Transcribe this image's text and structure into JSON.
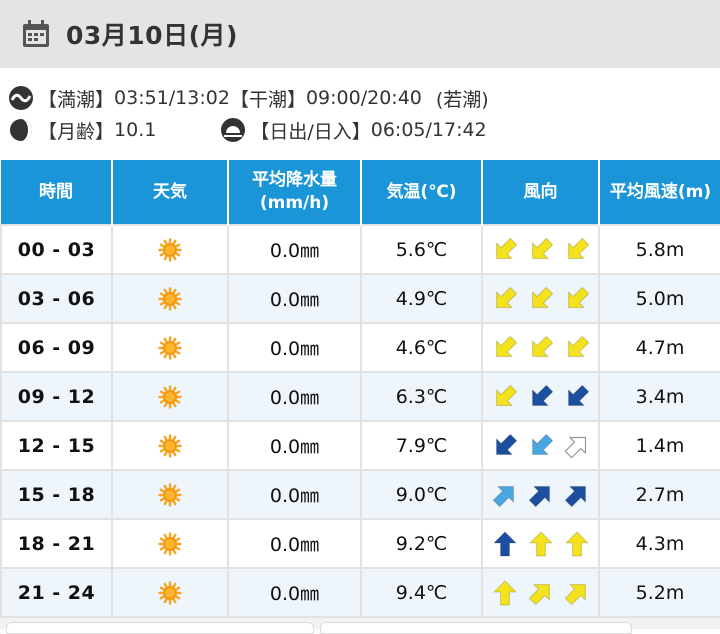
{
  "header": {
    "date": "03月10日(月)"
  },
  "tide": {
    "high_label": "【満潮】",
    "high": "03:51/13:02",
    "low_label": "【干潮】",
    "low": "09:00/20:40",
    "type": "(若潮)"
  },
  "moon": {
    "label": "【月齢】",
    "value": "10.1"
  },
  "sun": {
    "label": "【日出/日入】",
    "value": "06:05/17:42"
  },
  "columns": [
    "時間",
    "天気",
    "平均降水量",
    "(mm/h)",
    "気温(℃)",
    "風向",
    "平均風速(m)"
  ],
  "rows": [
    {
      "time": "00 - 03",
      "weather": "sunny-icon",
      "precip": "0.0㎜",
      "temp": "5.6℃",
      "speed": "5.8m",
      "winds": [
        {
          "dir": "sw",
          "color": "#f3e21c"
        },
        {
          "dir": "sw",
          "color": "#f3e21c"
        },
        {
          "dir": "sw",
          "color": "#f3e21c"
        }
      ]
    },
    {
      "time": "03 - 06",
      "weather": "sunny-icon",
      "precip": "0.0㎜",
      "temp": "4.9℃",
      "speed": "5.0m",
      "winds": [
        {
          "dir": "sw",
          "color": "#f3e21c"
        },
        {
          "dir": "sw",
          "color": "#f3e21c"
        },
        {
          "dir": "sw",
          "color": "#f3e21c"
        }
      ]
    },
    {
      "time": "06 - 09",
      "weather": "sunny-icon",
      "precip": "0.0㎜",
      "temp": "4.6℃",
      "speed": "4.7m",
      "winds": [
        {
          "dir": "sw",
          "color": "#f3e21c"
        },
        {
          "dir": "sw",
          "color": "#f3e21c"
        },
        {
          "dir": "sw",
          "color": "#f3e21c"
        }
      ]
    },
    {
      "time": "09 - 12",
      "weather": "sunny-icon",
      "precip": "0.0㎜",
      "temp": "6.3℃",
      "speed": "3.4m",
      "winds": [
        {
          "dir": "sw",
          "color": "#f3e21c"
        },
        {
          "dir": "sw",
          "color": "#1c4fa0"
        },
        {
          "dir": "sw",
          "color": "#1c4fa0"
        }
      ]
    },
    {
      "time": "12 - 15",
      "weather": "sunny-icon",
      "precip": "0.0㎜",
      "temp": "7.9℃",
      "speed": "1.4m",
      "winds": [
        {
          "dir": "sw",
          "color": "#1c4fa0"
        },
        {
          "dir": "sw",
          "color": "#4aa6e0"
        },
        {
          "dir": "ne",
          "color": "#ffffff"
        }
      ]
    },
    {
      "time": "15 - 18",
      "weather": "sunny-icon",
      "precip": "0.0㎜",
      "temp": "9.0℃",
      "speed": "2.7m",
      "winds": [
        {
          "dir": "ne",
          "color": "#4aa6e0"
        },
        {
          "dir": "ne",
          "color": "#1c4fa0"
        },
        {
          "dir": "ne",
          "color": "#1c4fa0"
        }
      ]
    },
    {
      "time": "18 - 21",
      "weather": "sunny-icon",
      "precip": "0.0㎜",
      "temp": "9.2℃",
      "speed": "4.3m",
      "winds": [
        {
          "dir": "n",
          "color": "#1c4fa0"
        },
        {
          "dir": "n",
          "color": "#f3e21c"
        },
        {
          "dir": "n",
          "color": "#f3e21c"
        }
      ]
    },
    {
      "time": "21 - 24",
      "weather": "sunny-icon",
      "precip": "0.0㎜",
      "temp": "9.4℃",
      "speed": "5.2m",
      "winds": [
        {
          "dir": "n",
          "color": "#f3e21c"
        },
        {
          "dir": "ne",
          "color": "#f3e21c"
        },
        {
          "dir": "ne",
          "color": "#f3e21c"
        }
      ]
    }
  ]
}
